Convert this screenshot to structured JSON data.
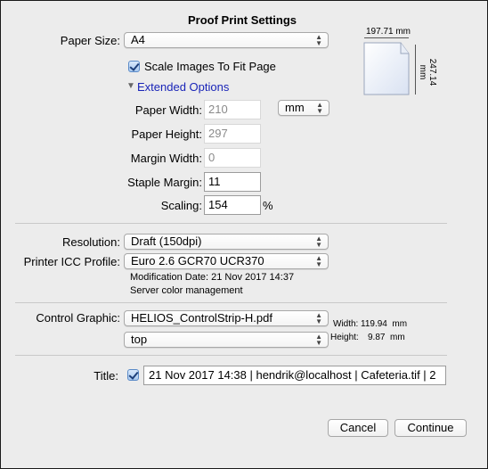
{
  "dialog": {
    "title": "Proof Print Settings"
  },
  "paper": {
    "size_label": "Paper Size:",
    "size_value": "A4",
    "preview": {
      "width_label": "197.71 mm",
      "height_label": "247.14 mm"
    },
    "scale_to_fit": {
      "label": "Scale Images To Fit Page",
      "checked": true
    },
    "extended_options_label": "Extended Options",
    "width_label": "Paper Width:",
    "width_value": "210",
    "unit_value": "mm",
    "height_label": "Paper Height:",
    "height_value": "297",
    "margin_label": "Margin Width:",
    "margin_value": "0",
    "staple_label": "Staple Margin:",
    "staple_value": "11",
    "scaling_label": "Scaling:",
    "scaling_value": "154",
    "scaling_unit": "%"
  },
  "color": {
    "resolution_label": "Resolution:",
    "resolution_value": "Draft (150dpi)",
    "icc_label": "Printer ICC Profile:",
    "icc_value": "Euro 2.6 GCR70 UCR370",
    "mod_date": "Modification Date: 21 Nov 2017 14:37",
    "server_cm": "Server color management"
  },
  "control": {
    "label": "Control Graphic:",
    "file_value": "HELIOS_ControlStrip-H.pdf",
    "position_value": "top",
    "width_label": "Width:",
    "width_value": "119.94  mm",
    "height_label": "Height:",
    "height_value": "9.87  mm"
  },
  "title_row": {
    "label": "Title:",
    "checked": true,
    "value": "21 Nov 2017 14:38 | hendrik@localhost | Cafeteria.tif | 2"
  },
  "buttons": {
    "cancel": "Cancel",
    "continue": "Continue"
  }
}
